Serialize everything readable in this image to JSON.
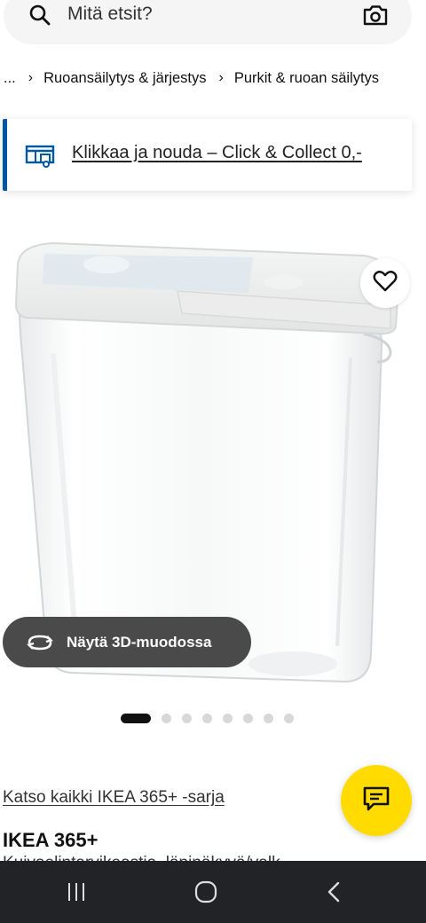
{
  "search": {
    "placeholder": "Mitä etsit?"
  },
  "breadcrumb": {
    "items": [
      "...",
      "Ruoansäilytys & järjestys",
      "Purkit & ruoan säilytys"
    ]
  },
  "promo": {
    "link": "Klikkaa ja nouda – Click & Collect 0,-"
  },
  "gallery": {
    "view3d_label": "Näytä 3D-muodossa",
    "image_count": 8,
    "active_index": 0
  },
  "product": {
    "series_link": "Katso kaikki IKEA 365+ -sarja",
    "name": "IKEA 365+",
    "description": "Kuivaelintarvikeastia, läpinäkyvä/valk..."
  },
  "colors": {
    "accent": "#0058a3",
    "chat": "#ffdb00",
    "navbar": "#222326"
  },
  "icons": [
    "search-icon",
    "camera-icon",
    "truck-icon",
    "heart-icon",
    "rotate-3d-icon",
    "chat-icon",
    "recent-apps-icon",
    "home-icon",
    "back-icon"
  ]
}
